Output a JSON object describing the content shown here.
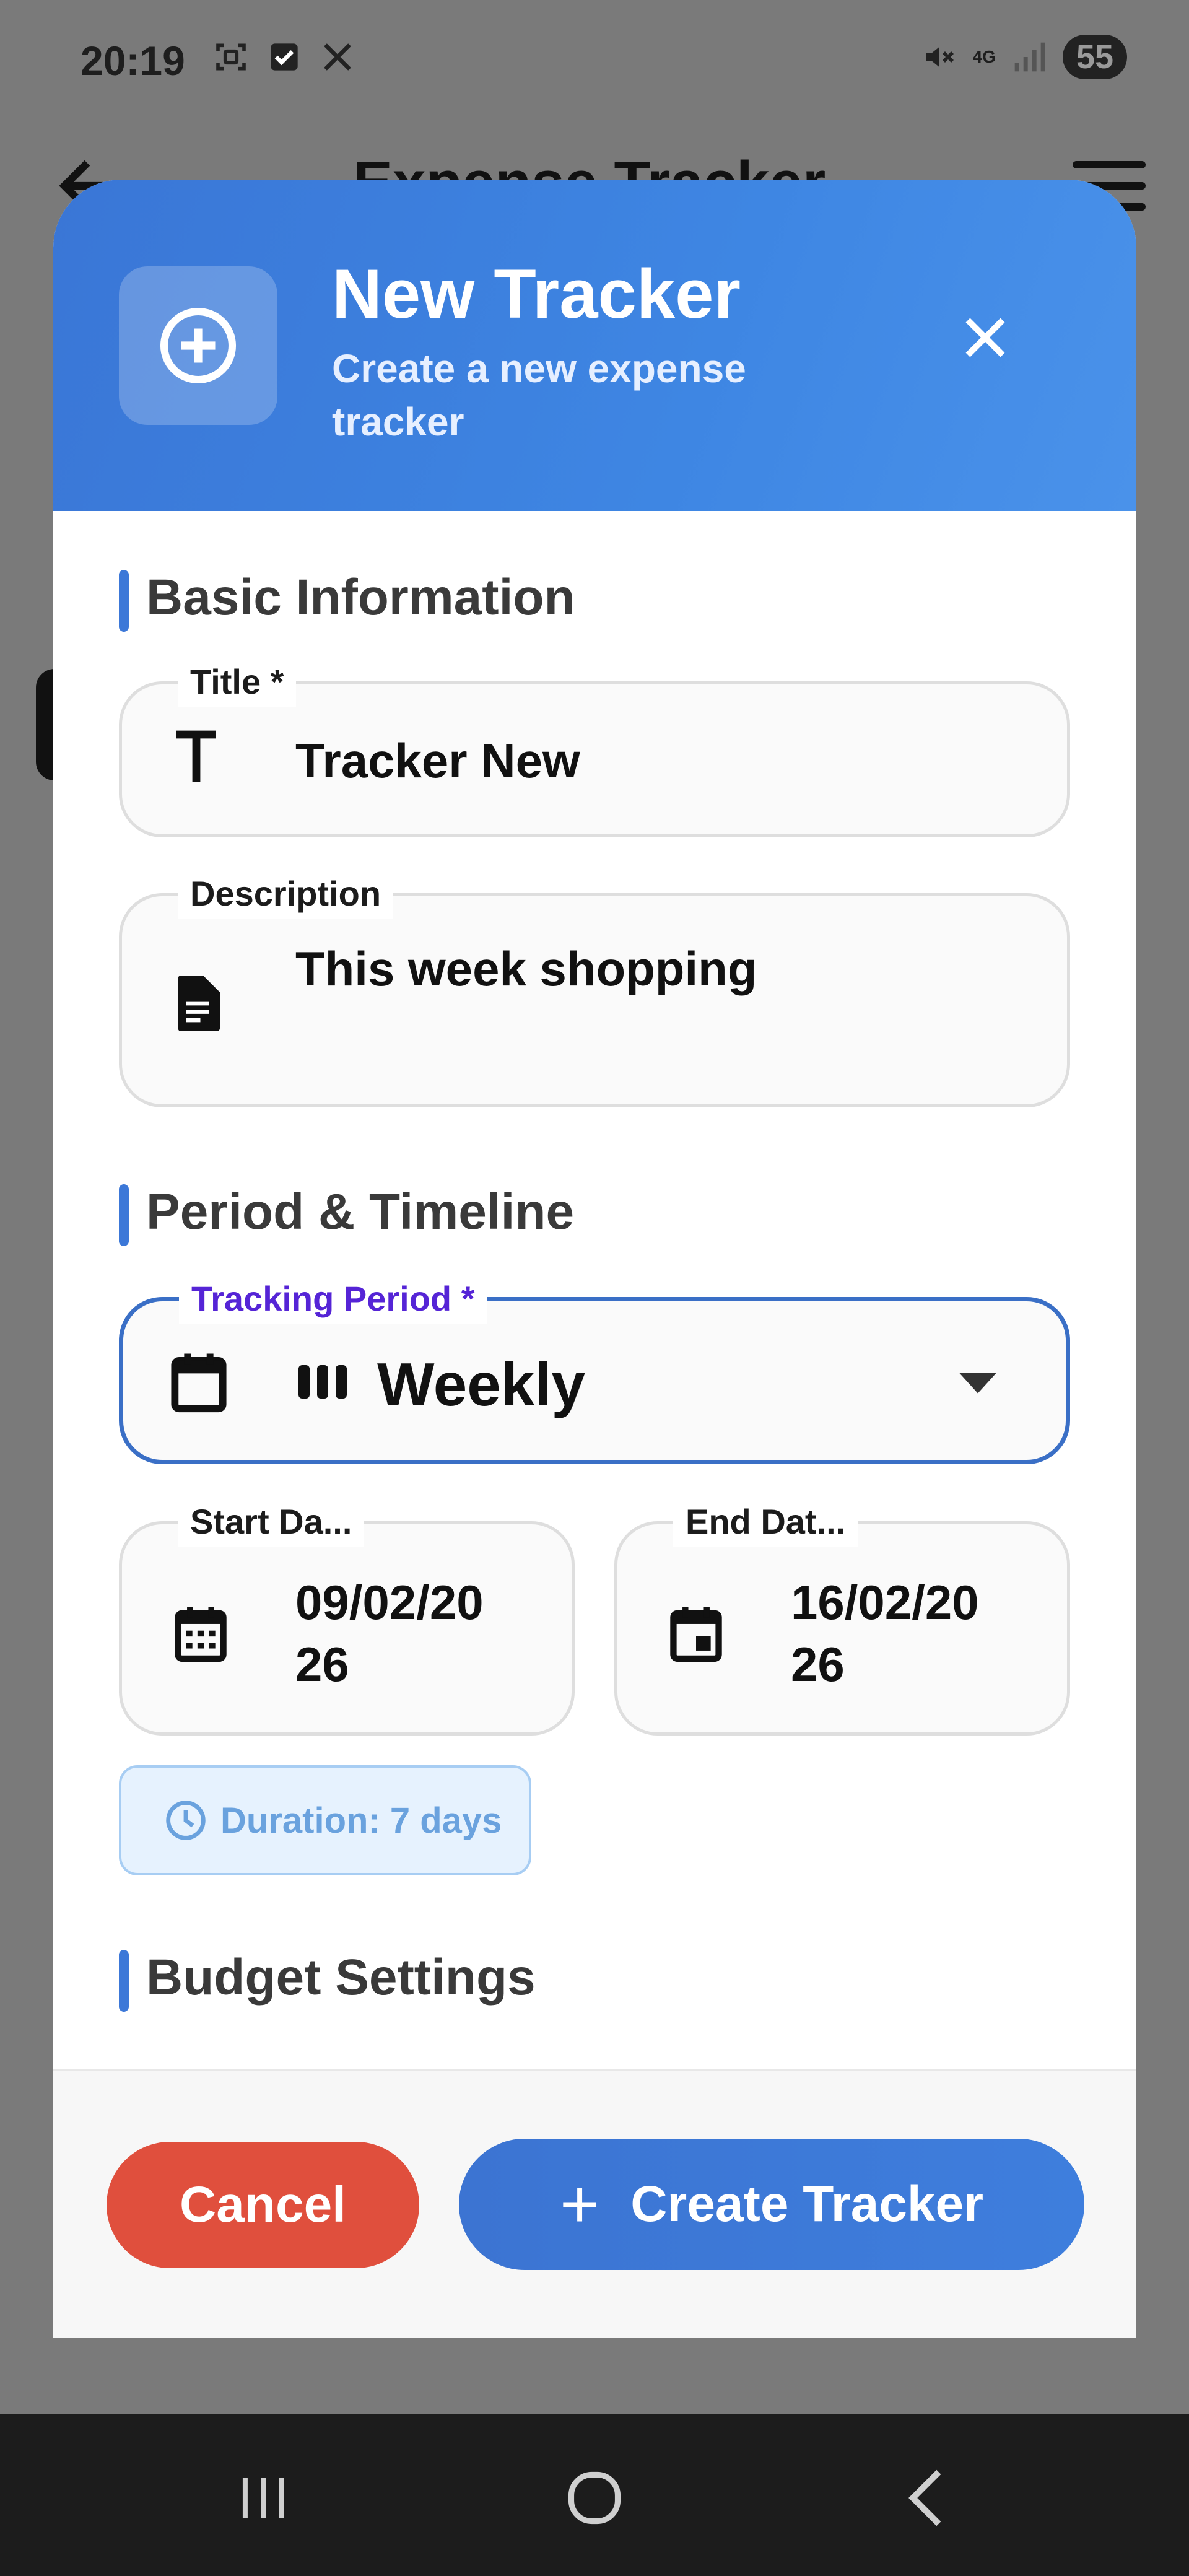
{
  "status_bar": {
    "time": "20:19",
    "network": "4G",
    "battery": "55"
  },
  "background_app": {
    "title": "Expense Tracker"
  },
  "modal": {
    "title": "New Tracker",
    "subtitle": "Create a new expense tracker",
    "sections": {
      "basic": "Basic Information",
      "period": "Period & Timeline",
      "budget": "Budget Settings"
    },
    "fields": {
      "title": {
        "label": "Title *",
        "value": "Tracker New"
      },
      "description": {
        "label": "Description",
        "value": "This week shopping"
      },
      "tracking_period": {
        "label": "Tracking Period *",
        "value": "Weekly"
      },
      "start_date": {
        "label": "Start Da...",
        "value_line1": "09/02/20",
        "value_line2": "26"
      },
      "end_date": {
        "label": "End Dat...",
        "value_line1": "16/02/20",
        "value_line2": "26"
      }
    },
    "duration": "Duration: 7 days",
    "buttons": {
      "cancel": "Cancel",
      "create": "Create Tracker"
    }
  },
  "colors": {
    "accent": "#3c78d8",
    "focus_label": "#5524d6",
    "cancel": "#e04f3d",
    "duration_bg": "#e6f2fe"
  }
}
